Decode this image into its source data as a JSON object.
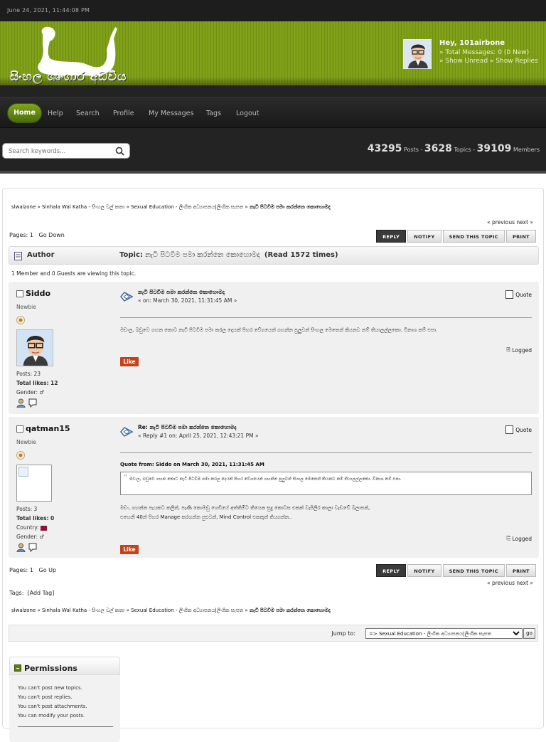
{
  "header": {
    "datetime": "June 24, 2021, 11:44:08 PM",
    "site_name": "සිංහල ශෘංගාර අඩවිය",
    "user": {
      "greeting": "Hey, 101airbone",
      "total_messages": "» Total Messages: 0 (0 New)",
      "show_links": "» Show Unread  » Show Replies"
    }
  },
  "nav": {
    "items": [
      "Home",
      "Help",
      "Search",
      "Profile",
      "My Messages",
      "Tags",
      "Logout"
    ],
    "search_placeholder": "Search keywords...",
    "stats": {
      "posts": "43295",
      "posts_label": "Posts -",
      "topics": "3628",
      "topics_label": "Topics -",
      "members": "39109",
      "members_label": "Members"
    }
  },
  "breadcrumb": [
    "slwalzone",
    "Sinhala Wal Katha - සිංහල වල් කතා",
    "Sexual Education - ලිංගික අධ්‍යාපනය|ලිංගික සැපත",
    "නැටි පිටවීම පමා කරන්නෙ කොහොමද"
  ],
  "breadcrumb_sep": "»",
  "prev_next": "« previous next »",
  "pages_top": {
    "label": "Pages:",
    "current": "1",
    "link": "Go Down"
  },
  "pages_bottom": {
    "label": "Pages:",
    "current": "1",
    "link": "Go Up"
  },
  "buttons": [
    "REPLY",
    "NOTIFY",
    "SEND THIS TOPIC",
    "PRINT"
  ],
  "topic_header": {
    "author": "Author",
    "topic_prefix": "Topic:",
    "topic_title": "නැටි පිටවීම පමා කරන්නෙ කොහොමද",
    "reads": "(Read 1572 times)"
  },
  "viewing": "1 Member and 0 Guests are viewing this topic.",
  "posts": [
    {
      "name": "Siddo",
      "rank": "Newbie",
      "stats": {
        "posts": "Posts: 23",
        "likes_label": "Total likes:",
        "likes": "12",
        "gender": "Gender: ♂"
      },
      "title": "නැටි පිටවීම පමා කරන්නෙ කොහොමද",
      "date": "« on: March 30, 2021, 11:31:45 AM »",
      "quote_label": "Quote",
      "body": "මචංල, බඩුවෙ ගහන කොට නැටි පිටවීම පමා කරල දෙයක් පිහර වේගයෙන් ගහන්න පුලුවන් සිංහල මෙතෙන් කියනව නම් තියාලල්ලකො. විනාශ නම් එපා.",
      "logged": "Logged",
      "like": "Like"
    },
    {
      "name": "qatman15",
      "rank": "Newbie",
      "stats": {
        "posts": "Posts: 3",
        "likes_label": "Total likes:",
        "likes": "0",
        "country": "Country:",
        "gender": "Gender: ♂"
      },
      "title": "Re: නැටි පිටවීම පමා කරන්නෙ කොහොමද",
      "date": "« Reply #1 on: April 25, 2021, 12:43:21 PM »",
      "quote_label": "Quote",
      "quote_from": "Quote from: Siddo on March 30, 2021, 11:31:45 AM",
      "quote_text": "මචංල, බඩුවෙ ගහන කොට නැටි පිටවීම පමා කරල දෙයක් පිහර වේගයෙන් ගහන්න පුලුවන් සිංහල මෙතෙන් කියනව නම් තියාලල්ලකො. විනාශ නම් එපා.",
      "body_line1": "මචං, ගහන්න පැයකට කලින්, පැණි කොමඩු ගෙඩියේ අත්තිම්ට තියෙන සුදු කොටස එකක් වැපිලිර කාලා වැඩවේ බලාපන්,",
      "body_line2": "එහෙනි 40න් පිහර Manage කරගන්න පුළුවන්, Mind Control එකකුත් තියගන්න..",
      "logged": "Logged",
      "like": "Like"
    }
  ],
  "tags_line": {
    "label": "Tags:",
    "add": "[Add Tag]"
  },
  "jump": {
    "label": "Jump to:",
    "selected": "=> Sexual Education - ලිංගික අධ්‍යාපනය|ලිංගික සැපත",
    "go": "go"
  },
  "permissions": {
    "title": "Permissions",
    "items": [
      "You can't post new topics.",
      "You can't post replies.",
      "You can't post attachments.",
      "You can modify your posts."
    ]
  }
}
